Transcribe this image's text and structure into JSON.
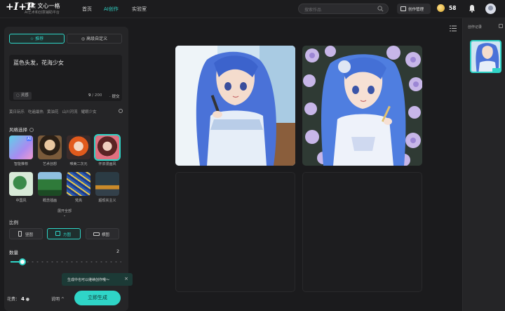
{
  "header": {
    "logo_mark": "+I+P",
    "brand_name": "飞桨 文心一格",
    "brand_sub": "AI艺术和创意辅助平台",
    "nav": [
      {
        "label": "首页",
        "active": false
      },
      {
        "label": "AI创作",
        "active": true
      },
      {
        "label": "实验室",
        "active": false
      }
    ],
    "search_placeholder": "搜索作品",
    "works_button": "创作管理",
    "coin_count": "58"
  },
  "left_panel": {
    "tabs": [
      {
        "label": "推荐",
        "icon": "star-icon",
        "active": true
      },
      {
        "label": "高级自定义",
        "icon": "settings-icon",
        "active": false
      }
    ],
    "prompt_text": "蓝色头发，花海少女",
    "inspiration_chip": "灵感",
    "char_count": "9",
    "char_limit": "/ 200",
    "submit_hint": "· 提交",
    "sample_prompts": [
      "莫日玩乐",
      "吃遍最热",
      "黄油花",
      "山川河流",
      "耀眼少女"
    ],
    "style_section": "风格选择",
    "styles": [
      {
        "label": "智能推荐",
        "selected": false
      },
      {
        "label": "艺术创想",
        "selected": false
      },
      {
        "label": "唯美二次元",
        "selected": false
      },
      {
        "label": "怀旧漫画风",
        "selected": true
      },
      {
        "label": "中国风",
        "selected": false
      },
      {
        "label": "概念插画",
        "selected": false
      },
      {
        "label": "梵高",
        "selected": false
      },
      {
        "label": "超现实主义",
        "selected": false
      }
    ],
    "expand_label": "展开全部",
    "ratio_section": "比例",
    "ratios": [
      {
        "label": "竖图",
        "active": false
      },
      {
        "label": "方图",
        "active": true
      },
      {
        "label": "横图",
        "active": false
      }
    ],
    "quantity_section": "数量",
    "quantity_value": "2",
    "quantity_fraction": 0.11,
    "toast": "生成中也可以继续创作哦～",
    "toast_close": "×",
    "consume_label": "花费：",
    "consume_value": "4",
    "help_label": "说明 ^",
    "generate_button": "立即生成"
  },
  "right_panel": {
    "title": "创作记录",
    "list_icon": "list-icon"
  },
  "colors": {
    "accent": "#2fd5c7",
    "background": "#1b1b1d",
    "panel": "#252527"
  }
}
